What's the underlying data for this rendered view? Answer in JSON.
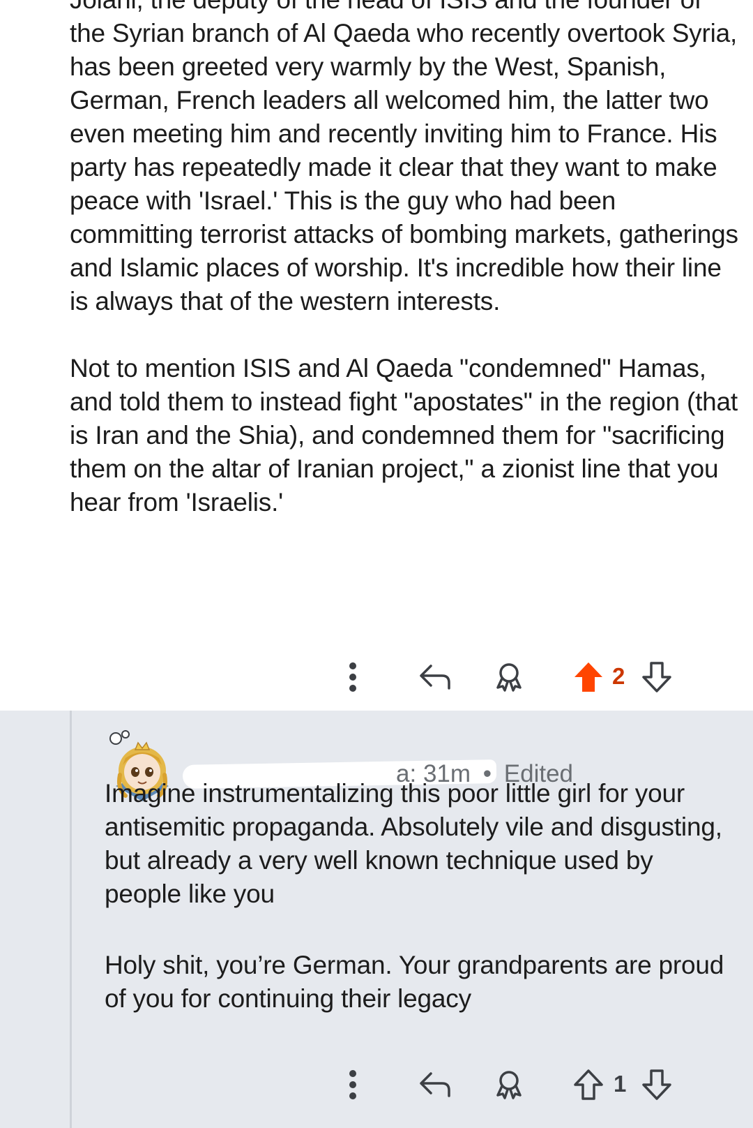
{
  "parent_comment": {
    "paragraphs": [
      "Jolani, the deputy of the head of ISIS and the founder of the Syrian branch of Al Qaeda who recently overtook Syria, has been greeted very warmly by the West, Spanish, German, French leaders all welcomed him, the latter two even meeting him and recently inviting him to France. His party has repeatedly made it clear that they want to make peace with 'Israel.' This is the guy who had been committing terrorist attacks of bombing markets, gatherings and Islamic places of worship. It's incredible how their line is always that of the western interests.",
      "Not to mention ISIS and Al Qaeda \"condemned\" Hamas, and told them to instead fight \"apostates\" in the region (that is Iran and the Shia), and condemned them for \"sacrificing them on the altar of Iranian project,\" a zionist line that you hear from 'Israelis.'"
    ],
    "actions": {
      "more_icon": "more-vertical-icon",
      "reply_icon": "reply-arrow-icon",
      "award_icon": "award-icon",
      "upvote_icon": "upvote-arrow-filled-icon",
      "downvote_icon": "downvote-arrow-icon",
      "score": "2",
      "upvoted": true,
      "upvote_color": "#ff4500",
      "score_color": "#cc3700"
    }
  },
  "reply_comment": {
    "avatar_icon": "user-avatar-anime-girl",
    "author_visible_suffix": "a:",
    "timestamp": "31m",
    "separator": "•",
    "edited_label": "Edited",
    "paragraphs": [
      "Imagine instrumentalizing this poor little girl for your antisemitic propaganda. Absolutely vile and disgusting, but already a very well known technique used by people like you",
      "Holy shit, you’re German. Your grandparents are proud of you for continuing their legacy"
    ],
    "actions": {
      "more_icon": "more-vertical-icon",
      "reply_icon": "reply-arrow-icon",
      "award_icon": "award-icon",
      "upvote_icon": "upvote-arrow-outline-icon",
      "downvote_icon": "downvote-arrow-icon",
      "score": "1",
      "upvoted": false
    },
    "background_color": "#e6e9ee"
  }
}
